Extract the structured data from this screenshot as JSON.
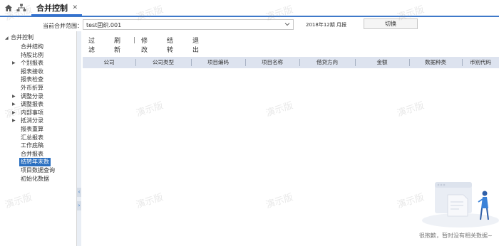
{
  "topbar": {
    "home_icon": "home-icon",
    "tree_icon": "org-tree-icon",
    "tab_label": "合并控制",
    "tab_close": "✕"
  },
  "header": {
    "scope_label": "当前合并范围：",
    "scope_value": "test固织.001",
    "period_text": "2018年12期  月报",
    "switch_label": "切换"
  },
  "sidebar": {
    "root_label": "合并控制",
    "items": [
      {
        "label": "合并结构",
        "caret": ""
      },
      {
        "label": "持股比例",
        "caret": ""
      },
      {
        "label": "个别报表",
        "caret": "▶"
      },
      {
        "label": "报表接收",
        "caret": ""
      },
      {
        "label": "报表检查",
        "caret": ""
      },
      {
        "label": "外币折算",
        "caret": ""
      },
      {
        "label": "调整分录",
        "caret": "▶"
      },
      {
        "label": "调整报表",
        "caret": "▶"
      },
      {
        "label": "内部事项",
        "caret": "▶"
      },
      {
        "label": "抵消分录",
        "caret": "▶"
      },
      {
        "label": "报表重算",
        "caret": ""
      },
      {
        "label": "汇总报表",
        "caret": ""
      },
      {
        "label": "工作底稿",
        "caret": ""
      },
      {
        "label": "合并报表",
        "caret": ""
      },
      {
        "label": "结转年末数",
        "caret": ""
      },
      {
        "label": "项目数据查询",
        "caret": ""
      },
      {
        "label": "初始化数据",
        "caret": ""
      }
    ],
    "selected_index": 14
  },
  "toolbar": {
    "filter": "过滤",
    "refresh": "刷新",
    "edit": "修改",
    "carry": "结转",
    "exit": "退出"
  },
  "table": {
    "columns": [
      "公司",
      "公司类型",
      "项目编码",
      "项目名称",
      "借贷方向",
      "金额",
      "数据种类",
      "币别代码"
    ]
  },
  "watermark": "演示版",
  "empty": {
    "message": "很抱歉，暂时没有相关数据~"
  },
  "colors": {
    "accent": "#2a6fc0",
    "header_bg": "#dde3ef"
  }
}
